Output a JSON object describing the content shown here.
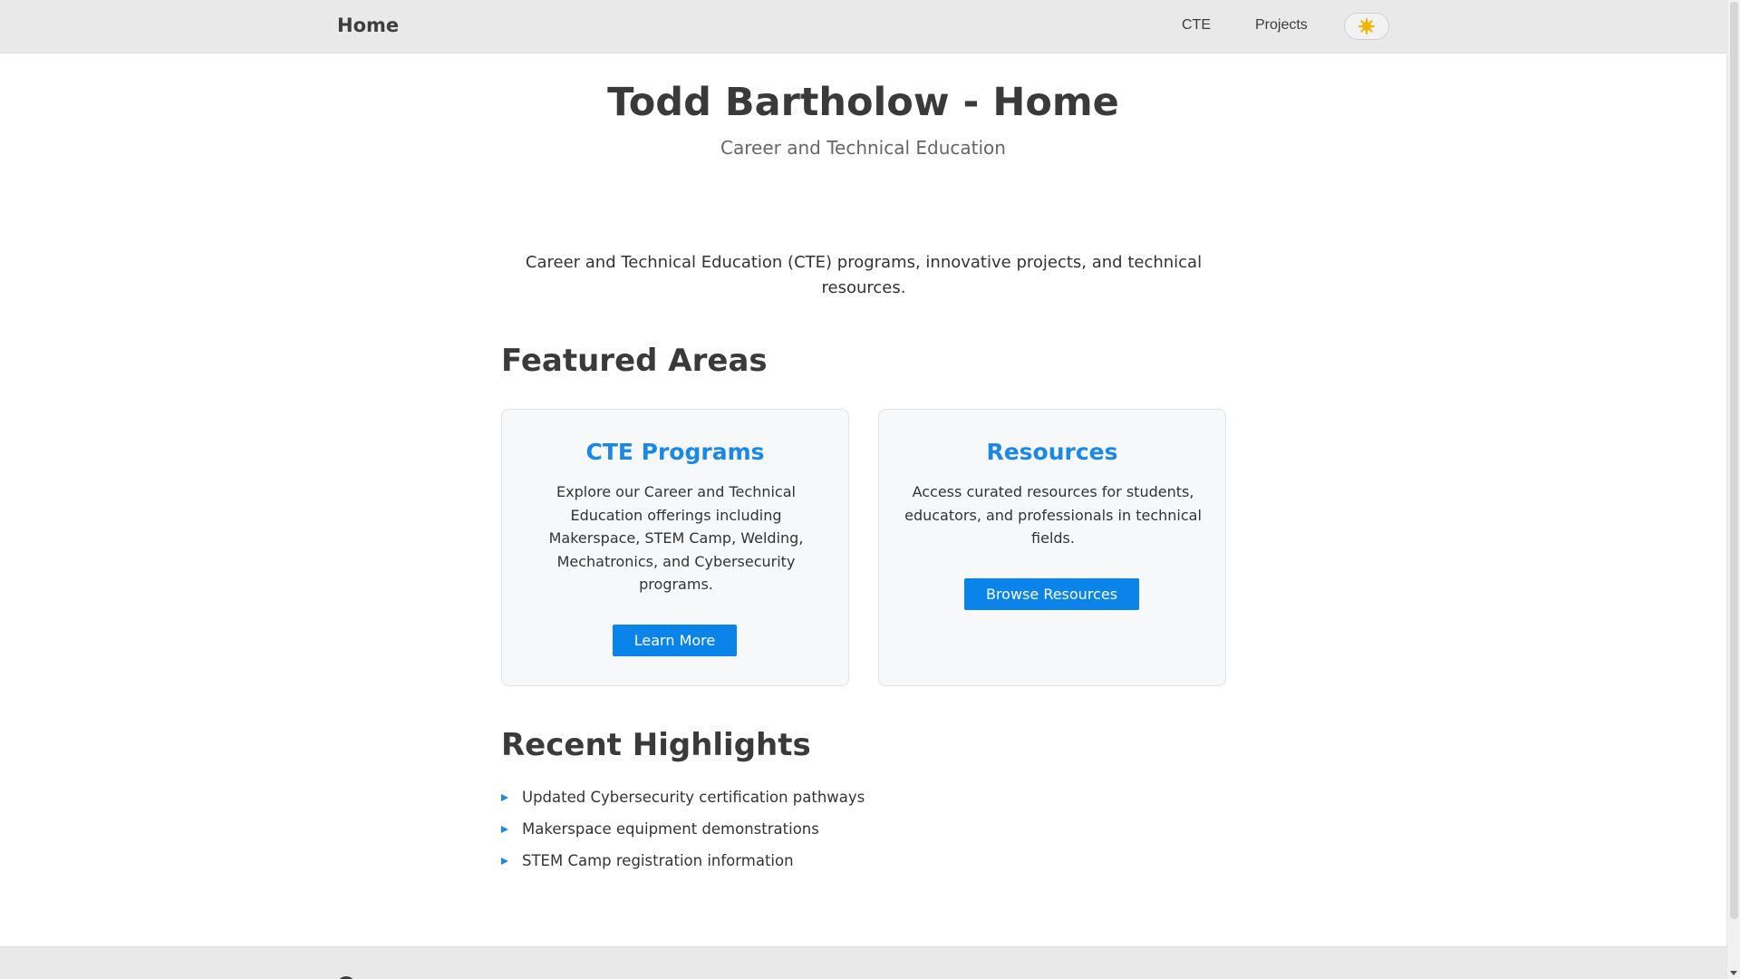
{
  "nav": {
    "brand": "Home",
    "links": [
      "CTE",
      "Projects"
    ],
    "theme_icon": "sun-icon"
  },
  "header": {
    "title": "Todd Bartholow - Home",
    "subtitle": "Career and Technical Education"
  },
  "intro": "Career and Technical Education (CTE) programs, innovative projects, and technical resources.",
  "featured": {
    "heading": "Featured Areas",
    "cards": [
      {
        "title": "CTE Programs",
        "description": "Explore our Career and Technical Education offerings including Makerspace, STEM Camp, Welding, Mechatronics, and Cybersecurity programs.",
        "button": "Learn More"
      },
      {
        "title": "Resources",
        "description": "Access curated resources for students, educators, and professionals in technical fields.",
        "button": "Browse Resources"
      }
    ]
  },
  "highlights": {
    "heading": "Recent Highlights",
    "items": [
      "Updated Cybersecurity certification pathways",
      "Makerspace equipment demonstrations",
      "STEM Camp registration information"
    ]
  },
  "colors": {
    "accent": "#1a88e6",
    "button": "#0a84e8",
    "nav_bg": "#e9e9e9",
    "card_bg": "#f7f8fa"
  }
}
